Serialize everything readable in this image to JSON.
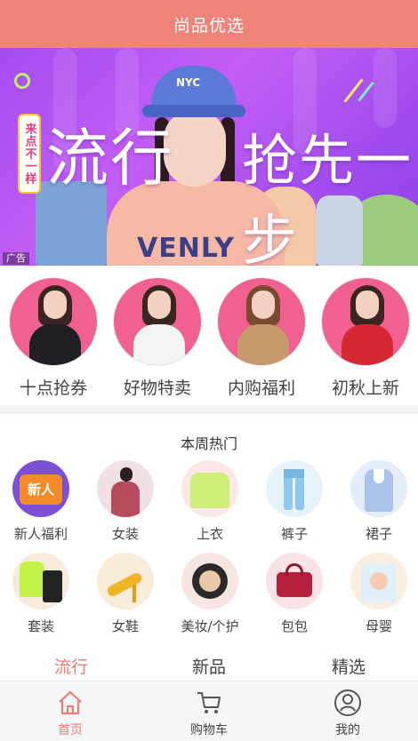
{
  "header": {
    "title": "尚品优选"
  },
  "banner": {
    "tag_text": "来点不一样",
    "word_left": "流行",
    "word_right": "抢先一步",
    "hat_text": "NYC",
    "hoodie_text": "VENLY",
    "ad_label": "广告"
  },
  "circle_nav": [
    {
      "label": "十点抢券"
    },
    {
      "label": "好物特卖"
    },
    {
      "label": "内购福利"
    },
    {
      "label": "初秋上新"
    }
  ],
  "hot": {
    "title": "本周热门",
    "badge_text": "新人",
    "categories": [
      {
        "label": "新人福利",
        "icon": "new-user-gift-icon"
      },
      {
        "label": "女装",
        "icon": "women-clothing-icon"
      },
      {
        "label": "上衣",
        "icon": "top-shirt-icon"
      },
      {
        "label": "裤子",
        "icon": "pants-icon"
      },
      {
        "label": "裙子",
        "icon": "dress-icon"
      },
      {
        "label": "套装",
        "icon": "outfit-set-icon"
      },
      {
        "label": "女鞋",
        "icon": "high-heel-icon"
      },
      {
        "label": "美妆/个护",
        "icon": "cushion-compact-icon"
      },
      {
        "label": "包包",
        "icon": "handbag-icon"
      },
      {
        "label": "母婴",
        "icon": "diapers-icon"
      }
    ]
  },
  "tabs": [
    {
      "label": "流行",
      "active": true
    },
    {
      "label": "新品",
      "active": false
    },
    {
      "label": "精选",
      "active": false
    }
  ],
  "bottom_nav": [
    {
      "label": "首页",
      "icon": "home-icon",
      "active": true
    },
    {
      "label": "购物车",
      "icon": "cart-icon",
      "active": false
    },
    {
      "label": "我的",
      "icon": "user-icon",
      "active": false
    }
  ],
  "colors": {
    "accent": "#f0837a",
    "active_text": "#ef7b72",
    "banner_purple": "#a54cf0"
  }
}
